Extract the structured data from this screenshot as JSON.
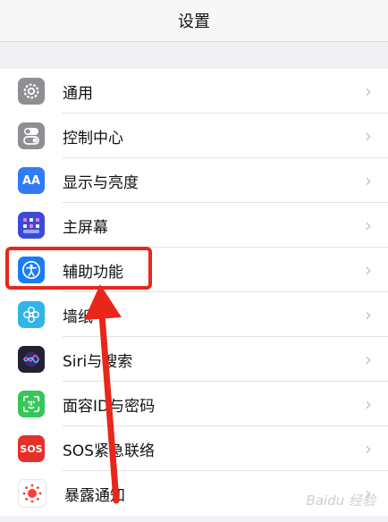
{
  "header": {
    "title": "设置"
  },
  "items": [
    {
      "label": "通用",
      "icon": "gear-icon",
      "color": "#8e8e93"
    },
    {
      "label": "控制中心",
      "icon": "switches-icon",
      "color": "#8e8e93"
    },
    {
      "label": "显示与亮度",
      "icon": "aa-text-icon",
      "icon_text": "AA",
      "color": "#2f7cf6"
    },
    {
      "label": "主屏幕",
      "icon": "home-grid-icon",
      "color": "#3b4bd8"
    },
    {
      "label": "辅助功能",
      "icon": "accessibility-icon",
      "color": "#1a7cf5"
    },
    {
      "label": "墙纸",
      "icon": "flower-icon",
      "color": "#31b4e8"
    },
    {
      "label": "Siri与搜索",
      "icon": "siri-icon",
      "color": "#222233"
    },
    {
      "label": "面容ID与密码",
      "icon": "face-id-icon",
      "color": "#35c759"
    },
    {
      "label": "SOS紧急联络",
      "icon": "sos-icon",
      "icon_text": "SOS",
      "color": "#e5302a"
    },
    {
      "label": "暴露通知",
      "icon": "exposure-icon",
      "color": "#ffffff"
    }
  ],
  "chevron": "›",
  "watermark": "Baidu 经验"
}
